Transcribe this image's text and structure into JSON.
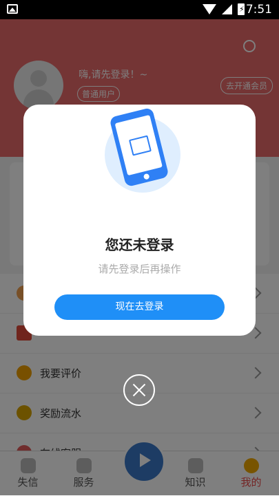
{
  "status_bar": {
    "time": "7:51",
    "battery_glyph": "⚡"
  },
  "header": {
    "greeting": "嗨,请先登录！~",
    "user_tag": "普通用户",
    "vip_button": "去开通会员"
  },
  "menu": {
    "items": [
      {
        "label": ""
      },
      {
        "label": ""
      },
      {
        "label": "我要评价"
      },
      {
        "label": "奖励流水"
      },
      {
        "label": "在线客服"
      }
    ]
  },
  "tabbar": {
    "tabs": [
      {
        "label": "失信"
      },
      {
        "label": "服务"
      },
      {
        "label": ""
      },
      {
        "label": "知识"
      },
      {
        "label": "我的"
      }
    ]
  },
  "modal": {
    "title": "您还未登录",
    "subtitle": "请先登录后再操作",
    "login_button": "现在去登录"
  },
  "colors": {
    "header": "#e86a6b",
    "primary": "#1f8ff7",
    "active_tab": "#e84a4a"
  }
}
